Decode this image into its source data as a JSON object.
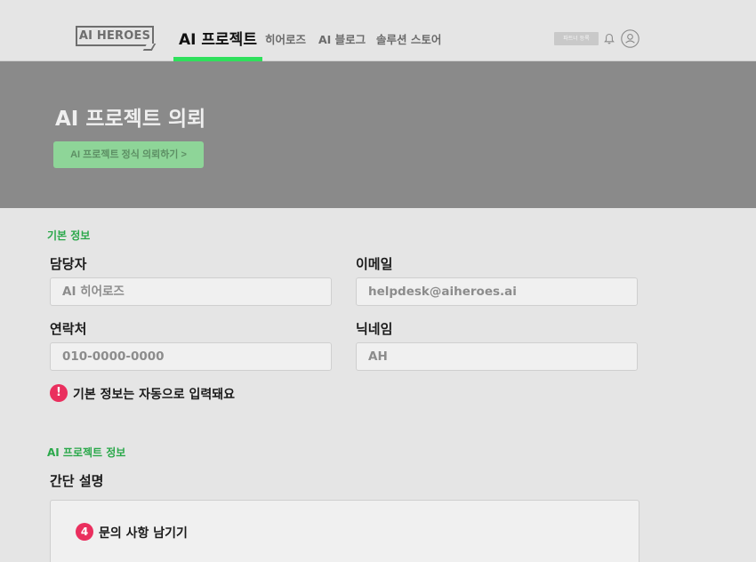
{
  "header": {
    "logo_text": "AI HEROES",
    "nav_active": "AI 프로젝트",
    "nav_items": [
      "히어로즈",
      "AI 블로그",
      "솔루션 스토어"
    ],
    "partner_button": "파트너 등록",
    "icons": {
      "notification": "bell-icon",
      "profile": "user-icon"
    },
    "accent_color": "#2fe05c"
  },
  "hero": {
    "title": "AI 프로젝트 의뢰",
    "cta_button": "AI 프로젝트 정식 의뢰하기 >"
  },
  "basic_info": {
    "section_title": "기본 정보",
    "manager_label": "담당자",
    "manager_value": "AI 히어로즈",
    "email_label": "이메일",
    "email_value": "helpdesk@aiheroes.ai",
    "phone_label": "연락처",
    "phone_value": "010-0000-0000",
    "nickname_label": "닉네임",
    "nickname_value": "AH",
    "notice_icon": "!",
    "notice_text": "기본 정보는 자동으로 입력돼요"
  },
  "project_info": {
    "section_title": "AI 프로젝트 정보",
    "summary_label": "간단 설명",
    "step_number": "4",
    "step_text": "문의 사항 남기기"
  }
}
